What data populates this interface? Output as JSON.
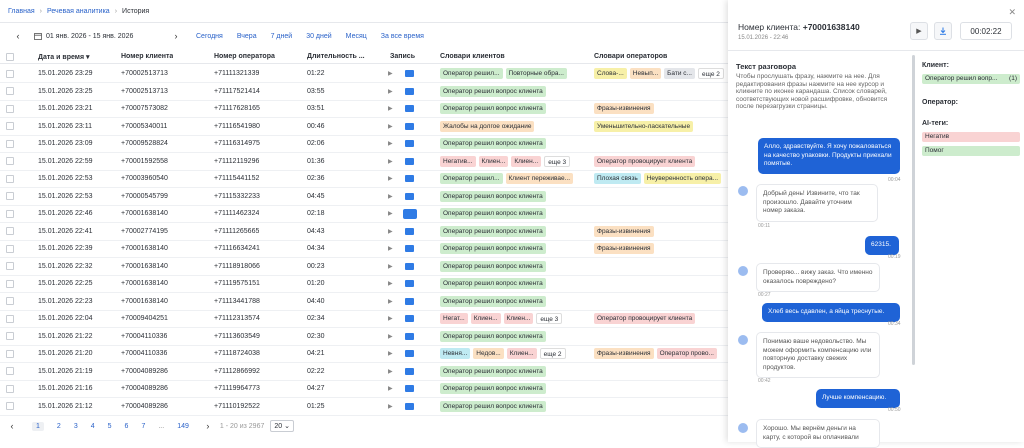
{
  "breadcrumb": {
    "home": "Главная",
    "section": "Речевая аналитика",
    "current": "История"
  },
  "filters": {
    "date_range": "01 янв. 2026 - 15 янв. 2026",
    "quick": [
      "Сегодня",
      "Вчера",
      "7 дней",
      "30 дней",
      "Месяц",
      "За все время"
    ]
  },
  "table": {
    "headers": {
      "datetime": "Дата и время",
      "client": "Номер клиента",
      "operator": "Номер оператора",
      "duration": "Длительность ...",
      "record": "Запись",
      "client_dicts": "Словари клиентов",
      "operator_dicts": "Словари операторов"
    },
    "rows": [
      {
        "dt": "15.01.2026 23:29",
        "cl": "+70002513713",
        "op": "+71111321339",
        "du": "01:22",
        "ct": [
          {
            "t": "Оператор решил...",
            "c": "g"
          },
          {
            "t": "Повторные обра...",
            "c": "g"
          }
        ],
        "ot": [
          {
            "t": "Слова-...",
            "c": "y"
          },
          {
            "t": "Невып...",
            "c": "o"
          },
          {
            "t": "Бати с...",
            "c": "gr"
          },
          {
            "t": "еще 2",
            "c": "w"
          }
        ]
      },
      {
        "dt": "15.01.2026 23:25",
        "cl": "+70002513713",
        "op": "+71117521414",
        "du": "03:55",
        "ct": [
          {
            "t": "Оператор решил вопрос клиента",
            "c": "g"
          }
        ],
        "ot": []
      },
      {
        "dt": "15.01.2026 23:21",
        "cl": "+70007573082",
        "op": "+71117628165",
        "du": "03:51",
        "ct": [
          {
            "t": "Оператор решил вопрос клиента",
            "c": "g"
          }
        ],
        "ot": [
          {
            "t": "Фразы-извинения",
            "c": "o"
          }
        ]
      },
      {
        "dt": "15.01.2026 23:11",
        "cl": "+70005340011",
        "op": "+71116541980",
        "du": "00:46",
        "ct": [
          {
            "t": "Жалобы на долгое ожидание",
            "c": "o"
          }
        ],
        "ot": [
          {
            "t": "Уменьшительно-ласкательные",
            "c": "y"
          }
        ]
      },
      {
        "dt": "15.01.2026 23:09",
        "cl": "+70009528824",
        "op": "+71116314975",
        "du": "02:06",
        "ct": [
          {
            "t": "Оператор решил вопрос клиента",
            "c": "g"
          }
        ],
        "ot": []
      },
      {
        "dt": "15.01.2026 22:59",
        "cl": "+70001592558",
        "op": "+71112119296",
        "du": "01:36",
        "ct": [
          {
            "t": "Негатив...",
            "c": "r"
          },
          {
            "t": "Клиен...",
            "c": "r"
          },
          {
            "t": "Клиен...",
            "c": "r"
          },
          {
            "t": "еще 3",
            "c": "w"
          }
        ],
        "ot": [
          {
            "t": "Оператор провоцирует клиента",
            "c": "r"
          }
        ]
      },
      {
        "dt": "15.01.2026 22:53",
        "cl": "+70003960540",
        "op": "+71115441152",
        "du": "02:36",
        "ct": [
          {
            "t": "Оператор решил...",
            "c": "g"
          },
          {
            "t": "Клиент переживае...",
            "c": "o"
          }
        ],
        "ot": [
          {
            "t": "Плохая связь",
            "c": "c"
          },
          {
            "t": "Неуверенность опера...",
            "c": "y"
          }
        ]
      },
      {
        "dt": "15.01.2026 22:53",
        "cl": "+70000545799",
        "op": "+71115332233",
        "du": "04:45",
        "ct": [
          {
            "t": "Оператор решил вопрос клиента",
            "c": "g"
          }
        ],
        "ot": []
      },
      {
        "dt": "15.01.2026 22:46",
        "cl": "+70001638140",
        "op": "+71111462324",
        "du": "02:18",
        "ct": [
          {
            "t": "Оператор решил вопрос клиента",
            "c": "g"
          }
        ],
        "ot": []
      },
      {
        "dt": "15.01.2026 22:41",
        "cl": "+70002774195",
        "op": "+71111265665",
        "du": "04:43",
        "ct": [
          {
            "t": "Оператор решил вопрос клиента",
            "c": "g"
          }
        ],
        "ot": [
          {
            "t": "Фразы-извинения",
            "c": "o"
          }
        ]
      },
      {
        "dt": "15.01.2026 22:39",
        "cl": "+70001638140",
        "op": "+71116634241",
        "du": "04:34",
        "ct": [
          {
            "t": "Оператор решил вопрос клиента",
            "c": "g"
          }
        ],
        "ot": [
          {
            "t": "Фразы-извинения",
            "c": "o"
          }
        ]
      },
      {
        "dt": "15.01.2026 22:32",
        "cl": "+70001638140",
        "op": "+71118918066",
        "du": "00:23",
        "ct": [
          {
            "t": "Оператор решил вопрос клиента",
            "c": "g"
          }
        ],
        "ot": []
      },
      {
        "dt": "15.01.2026 22:25",
        "cl": "+70001638140",
        "op": "+71119575151",
        "du": "01:20",
        "ct": [
          {
            "t": "Оператор решил вопрос клиента",
            "c": "g"
          }
        ],
        "ot": []
      },
      {
        "dt": "15.01.2026 22:23",
        "cl": "+70001638140",
        "op": "+71113441788",
        "du": "04:40",
        "ct": [
          {
            "t": "Оператор решил вопрос клиента",
            "c": "g"
          }
        ],
        "ot": []
      },
      {
        "dt": "15.01.2026 22:04",
        "cl": "+70009404251",
        "op": "+71112313574",
        "du": "02:34",
        "ct": [
          {
            "t": "Негат...",
            "c": "r"
          },
          {
            "t": "Клиен...",
            "c": "r"
          },
          {
            "t": "Клиен...",
            "c": "r"
          },
          {
            "t": "еще 3",
            "c": "w"
          }
        ],
        "ot": [
          {
            "t": "Оператор провоцирует клиента",
            "c": "r"
          }
        ]
      },
      {
        "dt": "15.01.2026 21:22",
        "cl": "+70004110336",
        "op": "+71113603549",
        "du": "02:30",
        "ct": [
          {
            "t": "Оператор решил вопрос клиента",
            "c": "g"
          }
        ],
        "ot": []
      },
      {
        "dt": "15.01.2026 21:20",
        "cl": "+70004110336",
        "op": "+71118724038",
        "du": "04:21",
        "ct": [
          {
            "t": "Невня...",
            "c": "c"
          },
          {
            "t": "Недов...",
            "c": "o"
          },
          {
            "t": "Клиен...",
            "c": "r"
          },
          {
            "t": "еще 2",
            "c": "w"
          }
        ],
        "ot": [
          {
            "t": "Фразы-извинения",
            "c": "o"
          },
          {
            "t": "Оператор прово...",
            "c": "r"
          }
        ]
      },
      {
        "dt": "15.01.2026 21:19",
        "cl": "+70004089286",
        "op": "+71112866992",
        "du": "02:22",
        "ct": [
          {
            "t": "Оператор решил вопрос клиента",
            "c": "g"
          }
        ],
        "ot": []
      },
      {
        "dt": "15.01.2026 21:16",
        "cl": "+70004089286",
        "op": "+71119964773",
        "du": "04:27",
        "ct": [
          {
            "t": "Оператор решил вопрос клиента",
            "c": "g"
          }
        ],
        "ot": []
      },
      {
        "dt": "15.01.2026 21:12",
        "cl": "+70004089286",
        "op": "+71110192522",
        "du": "01:25",
        "ct": [
          {
            "t": "Оператор решил вопрос клиента",
            "c": "g"
          }
        ],
        "ot": []
      }
    ]
  },
  "pager": {
    "pages": [
      "1",
      "2",
      "3",
      "4",
      "5",
      "6",
      "7",
      "...",
      "149"
    ],
    "range": "1 - 20 из 2967",
    "size": "20"
  },
  "panel": {
    "phone_label": "Номер клиента:",
    "phone": "+70001638140",
    "date": "15.01.2026 - 22:46",
    "timer": "00:02:22",
    "transcript_title": "Текст разговора",
    "transcript_hint": "Чтобы прослушать фразу, нажмите на нее. Для редактирования фразы нажмите на нее курсор и кликните по иконке карандаша. Список словарей, соответствующих новой расшифровке, обновится после перезагрузки страницы.",
    "messages": [
      {
        "text": "Алло, здравствуйте. Я хочу пожаловаться на качество упаковки. Продукты приехали помятые.",
        "time": "00:04"
      },
      {
        "text": "Добрый день! Извините, что так произошло. Давайте уточним номер заказа.",
        "time": "00:11"
      },
      {
        "text": "62315.",
        "time": "00:19"
      },
      {
        "text": "Проверяю... вижу заказ. Что именно оказалось повреждено?",
        "time": "00:27"
      },
      {
        "text": "Хлеб весь сдавлен, а яйца треснутые.",
        "time": "00:34"
      },
      {
        "text": "Понимаю ваше недовольство. Мы можем оформить компенсацию или повторную доставку свежих продуктов.",
        "time": "00:42"
      },
      {
        "text": "Лучше компенсацию.",
        "time": "00:50"
      },
      {
        "text": "Хорошо. Мы вернём деньги на карту, с которой вы оплачивали",
        "time": ""
      }
    ],
    "client_label": "Клиент:",
    "client_tag": "Оператор решил вопр...",
    "client_tag_count": "(1)",
    "operator_label": "Оператор:",
    "ai_label": "AI-теги:",
    "ai_tags": [
      "Негатив",
      "Помог"
    ],
    "colors": {
      "accent": "#1f63d6",
      "green_tag": "#cdeccd",
      "red_tag": "#f9d3d3"
    }
  }
}
